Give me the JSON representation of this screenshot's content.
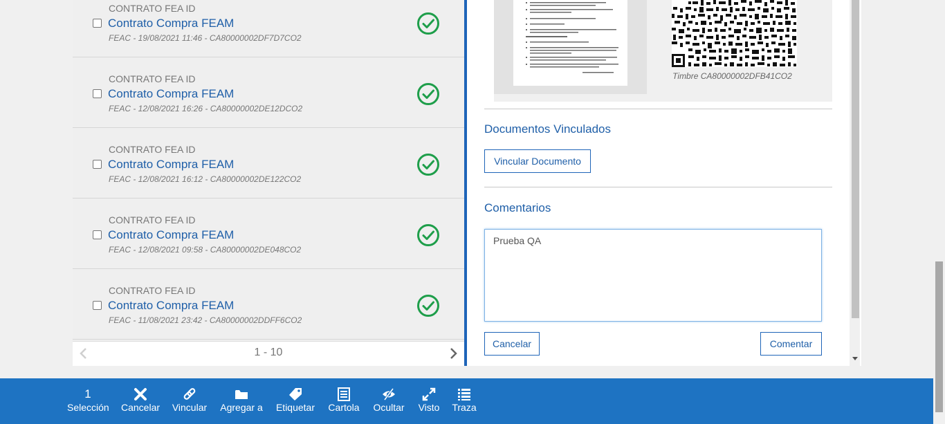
{
  "list": {
    "items": [
      {
        "type": "CONTRATO FEA ID",
        "title": "Contrato Compra FEAM",
        "meta": "FEAC - 19/08/2021 11:46 - CA80000002DF7D7CO2"
      },
      {
        "type": "CONTRATO FEA ID",
        "title": "Contrato Compra FEAM",
        "meta": "FEAC - 12/08/2021 16:26 - CA80000002DE12DCO2"
      },
      {
        "type": "CONTRATO FEA ID",
        "title": "Contrato Compra FEAM",
        "meta": "FEAC - 12/08/2021 16:12 - CA80000002DE122CO2"
      },
      {
        "type": "CONTRATO FEA ID",
        "title": "Contrato Compra FEAM",
        "meta": "FEAC - 12/08/2021 09:58 - CA80000002DE048CO2"
      },
      {
        "type": "CONTRATO FEA ID",
        "title": "Contrato Compra FEAM",
        "meta": "FEAC - 11/08/2021 23:42 - CA80000002DDFF6CO2"
      }
    ],
    "pager": {
      "range": "1 - 10"
    }
  },
  "detail": {
    "timbre_caption": "Timbre CA80000002DFB41CO2",
    "linked_docs_title": "Documentos Vinculados",
    "link_doc_button": "Vincular Documento",
    "comments_title": "Comentarios",
    "comment_value": "Prueba QA",
    "cancel_button": "Cancelar",
    "comment_button": "Comentar"
  },
  "toolbar": {
    "selection_count": "1",
    "items": [
      {
        "label": "Selección",
        "icon": "selection-count"
      },
      {
        "label": "Cancelar",
        "icon": "x-icon"
      },
      {
        "label": "Vincular",
        "icon": "link-icon"
      },
      {
        "label": "Agregar a",
        "icon": "folder-icon"
      },
      {
        "label": "Etiquetar",
        "icon": "tag-icon"
      },
      {
        "label": "Cartola",
        "icon": "list-doc-icon"
      },
      {
        "label": "Ocultar",
        "icon": "eye-slash-icon"
      },
      {
        "label": "Visto",
        "icon": "expand-icon"
      },
      {
        "label": "Traza",
        "icon": "list-icon"
      }
    ]
  },
  "colors": {
    "accent": "#1e73c2",
    "link": "#1f5fa8",
    "success": "#1e9e4a"
  }
}
